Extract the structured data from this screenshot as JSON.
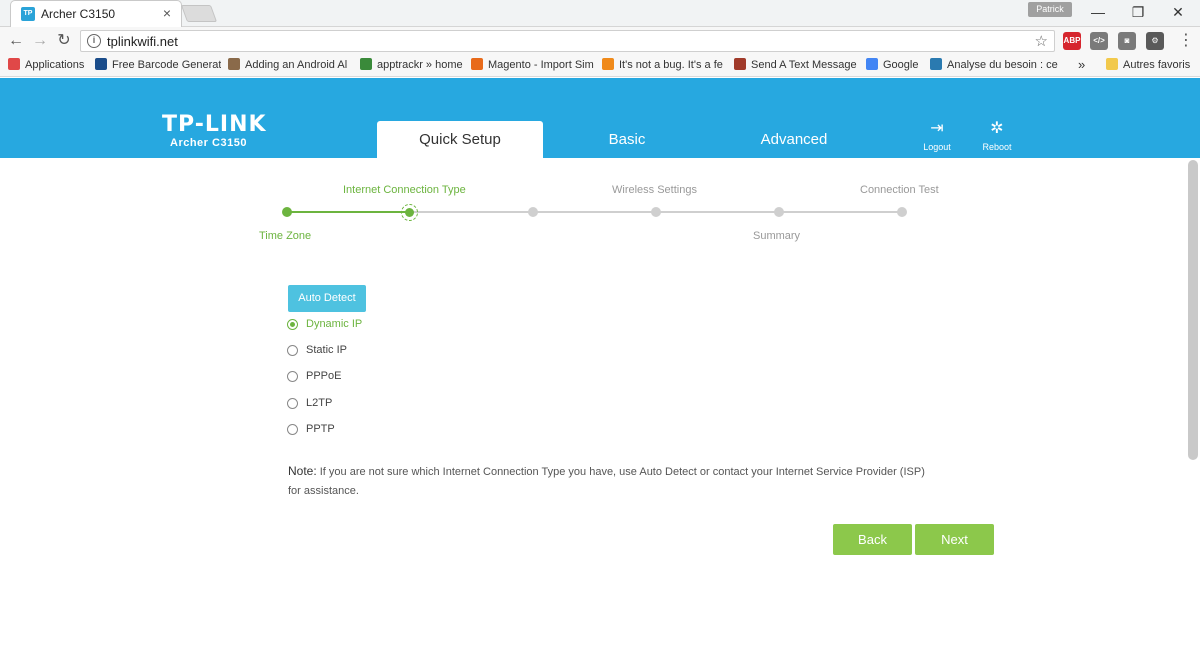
{
  "browser": {
    "tab_title": "Archer C3150",
    "tab_favicon_text": "TP",
    "profile_name": "Patrick",
    "url": "tplinkwifi.net",
    "window_controls": {
      "minimize": "—",
      "restore": "❐",
      "close": "✕"
    },
    "nav": {
      "back": "←",
      "forward": "→",
      "reload": "↻"
    },
    "extensions": [
      {
        "name": "adblock-plus",
        "text": "ABP",
        "color": "#d6262e"
      },
      {
        "name": "dev-tools",
        "text": "</>",
        "color": "#7a7a7a"
      },
      {
        "name": "screenshot",
        "text": "◙",
        "color": "#7a7a7a"
      },
      {
        "name": "settings",
        "text": "⚙",
        "color": "#5a5a5a"
      }
    ],
    "menu_icon": "⋮",
    "bookmarks": [
      {
        "label": "Applications",
        "icon_color": "#e04848"
      },
      {
        "label": "Free Barcode Generat",
        "icon_color": "#1a4c8a"
      },
      {
        "label": "Adding an Android Al",
        "icon_color": "#8a6a4a"
      },
      {
        "label": "apptrackr » home",
        "icon_color": "#3a8a3a"
      },
      {
        "label": "Magento - Import Sim",
        "icon_color": "#e86a1a"
      },
      {
        "label": "It's not a bug. It's a fe",
        "icon_color": "#f08a1a"
      },
      {
        "label": "Send A Text Message",
        "icon_color": "#a03a2a"
      },
      {
        "label": "Google",
        "icon_color": "#4285f4"
      },
      {
        "label": "Analyse du besoin : ce",
        "icon_color": "#2a7ab0"
      }
    ],
    "bookmarks_overflow": "»",
    "other_bookmarks": "Autres favoris"
  },
  "router": {
    "logo": "TP-LINK",
    "model": "Archer C3150",
    "tabs": [
      {
        "label": "Quick Setup",
        "active": true
      },
      {
        "label": "Basic",
        "active": false
      },
      {
        "label": "Advanced",
        "active": false
      }
    ],
    "actions": [
      {
        "label": "Logout",
        "glyph": "⇥"
      },
      {
        "label": "Reboot",
        "glyph": "✲"
      }
    ],
    "accent_color": "#27a8e0",
    "success_color": "#6cb43f"
  },
  "wizard": {
    "steps": [
      {
        "label": "Time Zone",
        "state": "done"
      },
      {
        "label": "Internet Connection Type",
        "state": "current"
      },
      {
        "label": "",
        "state": "pending"
      },
      {
        "label": "Wireless Settings",
        "state": "pending"
      },
      {
        "label": "Summary",
        "state": "pending"
      },
      {
        "label": "Connection Test",
        "state": "pending"
      }
    ],
    "auto_detect_label": "Auto Detect",
    "connection_types": [
      {
        "label": "Dynamic IP",
        "checked": true
      },
      {
        "label": "Static IP",
        "checked": false
      },
      {
        "label": "PPPoE",
        "checked": false
      },
      {
        "label": "L2TP",
        "checked": false
      },
      {
        "label": "PPTP",
        "checked": false
      }
    ],
    "note_label": "Note:",
    "note_text": "If you are not sure which Internet Connection Type you have, use Auto Detect or contact your Internet Service Provider (ISP) for assistance.",
    "back_label": "Back",
    "next_label": "Next"
  }
}
